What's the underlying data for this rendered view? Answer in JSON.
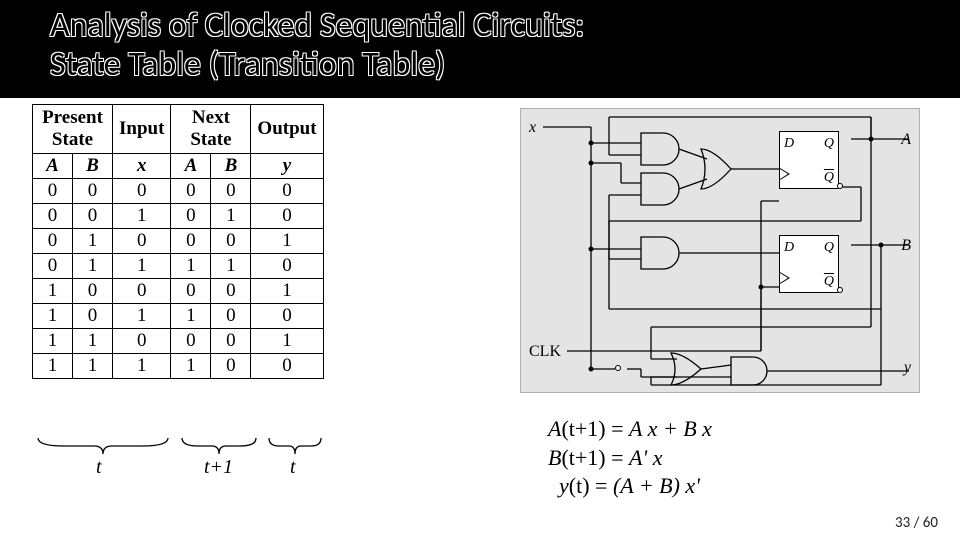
{
  "title_line1": "Analysis of Clocked Sequential Circuits:",
  "title_line2": "State Table (Transition Table)",
  "headers": {
    "present": "Present State",
    "input": "Input",
    "next": "Next State",
    "output": "Output"
  },
  "subheaders": {
    "A": "A",
    "B": "B",
    "x": "x",
    "An": "A",
    "Bn": "B",
    "y": "y"
  },
  "rows": [
    {
      "A": "0",
      "B": "0",
      "x": "0",
      "An": "0",
      "Bn": "0",
      "y": "0"
    },
    {
      "A": "0",
      "B": "0",
      "x": "1",
      "An": "0",
      "Bn": "1",
      "y": "0"
    },
    {
      "A": "0",
      "B": "1",
      "x": "0",
      "An": "0",
      "Bn": "0",
      "y": "1"
    },
    {
      "A": "0",
      "B": "1",
      "x": "1",
      "An": "1",
      "Bn": "1",
      "y": "0"
    },
    {
      "A": "1",
      "B": "0",
      "x": "0",
      "An": "0",
      "Bn": "0",
      "y": "1"
    },
    {
      "A": "1",
      "B": "0",
      "x": "1",
      "An": "1",
      "Bn": "0",
      "y": "0"
    },
    {
      "A": "1",
      "B": "1",
      "x": "0",
      "An": "0",
      "Bn": "0",
      "y": "1"
    },
    {
      "A": "1",
      "B": "1",
      "x": "1",
      "An": "1",
      "Bn": "0",
      "y": "0"
    }
  ],
  "time": {
    "t": "t",
    "tp1": "t+1",
    "t2": "t"
  },
  "circuit": {
    "x": "x",
    "clk": "CLK",
    "A": "A",
    "B": "B",
    "y": "y",
    "D": "D",
    "Q": "Q",
    "Qb": "Q"
  },
  "formulas": {
    "f1a": "A",
    "f1t": "(t+1)",
    "f1eq": " = ",
    "f1r": "A x + B x",
    "f2a": "B",
    "f2t": "(t+1)",
    "f2eq": " = ",
    "f2r": "A' x",
    "f3a": "y",
    "f3t": "(t)",
    "f3eq": "   = ",
    "f3r": "(A + B) x'"
  },
  "pager": "33 / 60",
  "chart_data": {
    "type": "table",
    "title": "State (Transition) Table",
    "column_groups": [
      "Present State",
      "Input",
      "Next State",
      "Output"
    ],
    "columns": [
      "A",
      "B",
      "x",
      "A(next)",
      "B(next)",
      "y"
    ],
    "rows": [
      [
        0,
        0,
        0,
        0,
        0,
        0
      ],
      [
        0,
        0,
        1,
        0,
        1,
        0
      ],
      [
        0,
        1,
        0,
        0,
        0,
        1
      ],
      [
        0,
        1,
        1,
        1,
        1,
        0
      ],
      [
        1,
        0,
        0,
        0,
        0,
        1
      ],
      [
        1,
        0,
        1,
        1,
        0,
        0
      ],
      [
        1,
        1,
        0,
        0,
        0,
        1
      ],
      [
        1,
        1,
        1,
        1,
        0,
        0
      ]
    ],
    "time_annotation": {
      "present_input": "t",
      "next": "t+1",
      "output": "t"
    },
    "equations": [
      "A(t+1) = A x + B x",
      "B(t+1) = A' x",
      "y(t) = (A + B) x'"
    ]
  }
}
